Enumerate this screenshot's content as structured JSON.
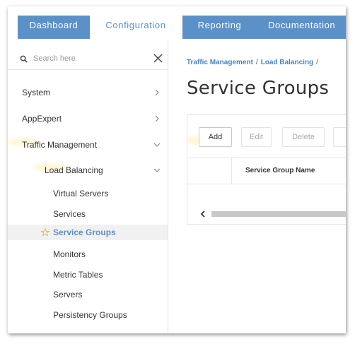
{
  "topnav": {
    "tabs": [
      {
        "label": "Dashboard"
      },
      {
        "label": "Configuration"
      },
      {
        "label": "Reporting"
      },
      {
        "label": "Documentation"
      }
    ],
    "active_tab": "Configuration"
  },
  "sidebar": {
    "search_placeholder": "Search here",
    "items": [
      {
        "label": "System"
      },
      {
        "label": "AppExpert"
      },
      {
        "label": "Traffic Management"
      },
      {
        "label": "Load Balancing"
      },
      {
        "label": "Virtual Servers"
      },
      {
        "label": "Services"
      },
      {
        "label": "Service Groups"
      },
      {
        "label": "Monitors"
      },
      {
        "label": "Metric Tables"
      },
      {
        "label": "Servers"
      },
      {
        "label": "Persistency Groups"
      }
    ]
  },
  "main": {
    "breadcrumb": [
      "Traffic Management",
      "Load Balancing"
    ],
    "breadcrumb_sep": "/",
    "title": "Service Groups",
    "toolbar": {
      "add": "Add",
      "edit": "Edit",
      "delete": "Delete"
    },
    "table": {
      "columns": [
        "Service Group Name"
      ]
    }
  },
  "colors": {
    "accent": "#5a91c9",
    "link": "#4b84c1"
  }
}
